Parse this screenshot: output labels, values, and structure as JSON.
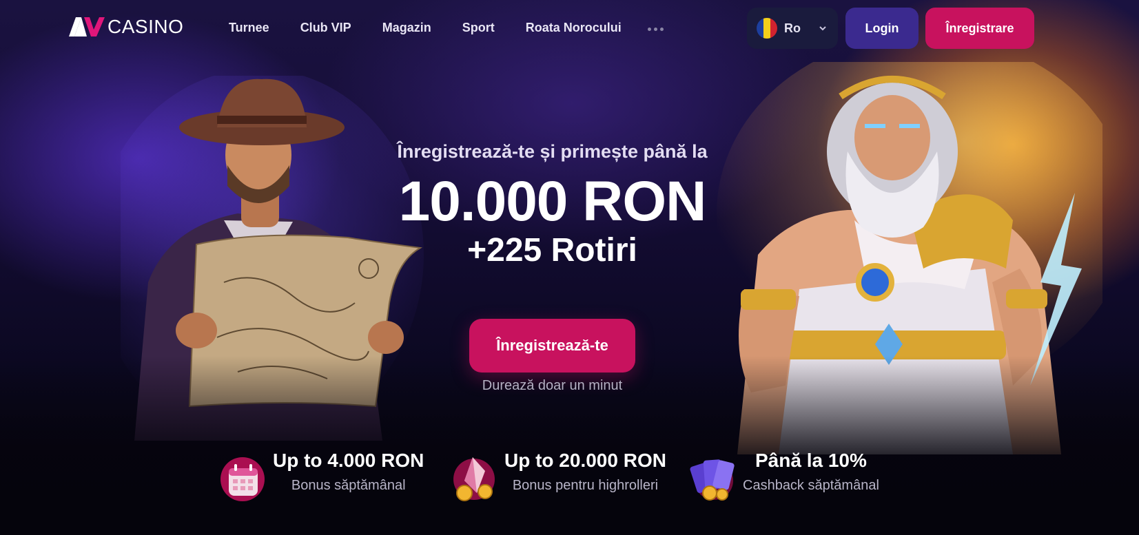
{
  "brand": {
    "logo_text": "CASINO",
    "colors": {
      "accent": "#c8125e",
      "login": "#3b2a8f",
      "background": "#05040c"
    }
  },
  "nav": {
    "items": [
      {
        "label": "Turnee"
      },
      {
        "label": "Club VIP"
      },
      {
        "label": "Magazin"
      },
      {
        "label": "Sport"
      },
      {
        "label": "Roata Norocului"
      }
    ],
    "more_icon": "more-dots-icon"
  },
  "language": {
    "label": "Ro",
    "flag": "romania-flag-icon"
  },
  "auth": {
    "login_label": "Login",
    "register_label": "Înregistrare"
  },
  "hero": {
    "subtitle": "Înregistrează-te și primește până la",
    "amount": "10.000 RON",
    "spins": "+225 Rotiri",
    "cta_label": "Înregistrează-te",
    "cta_note": "Durează doar un minut"
  },
  "features": [
    {
      "title": "Up to 4.000 RON",
      "subtitle": "Bonus săptămânal",
      "icon": "calendar-icon"
    },
    {
      "title": "Up to 20.000 RON",
      "subtitle": "Bonus pentru highrolleri",
      "icon": "gem-coins-icon"
    },
    {
      "title": "Până la 10%",
      "subtitle": "Cashback săptămânal",
      "icon": "cards-cashback-icon"
    }
  ]
}
